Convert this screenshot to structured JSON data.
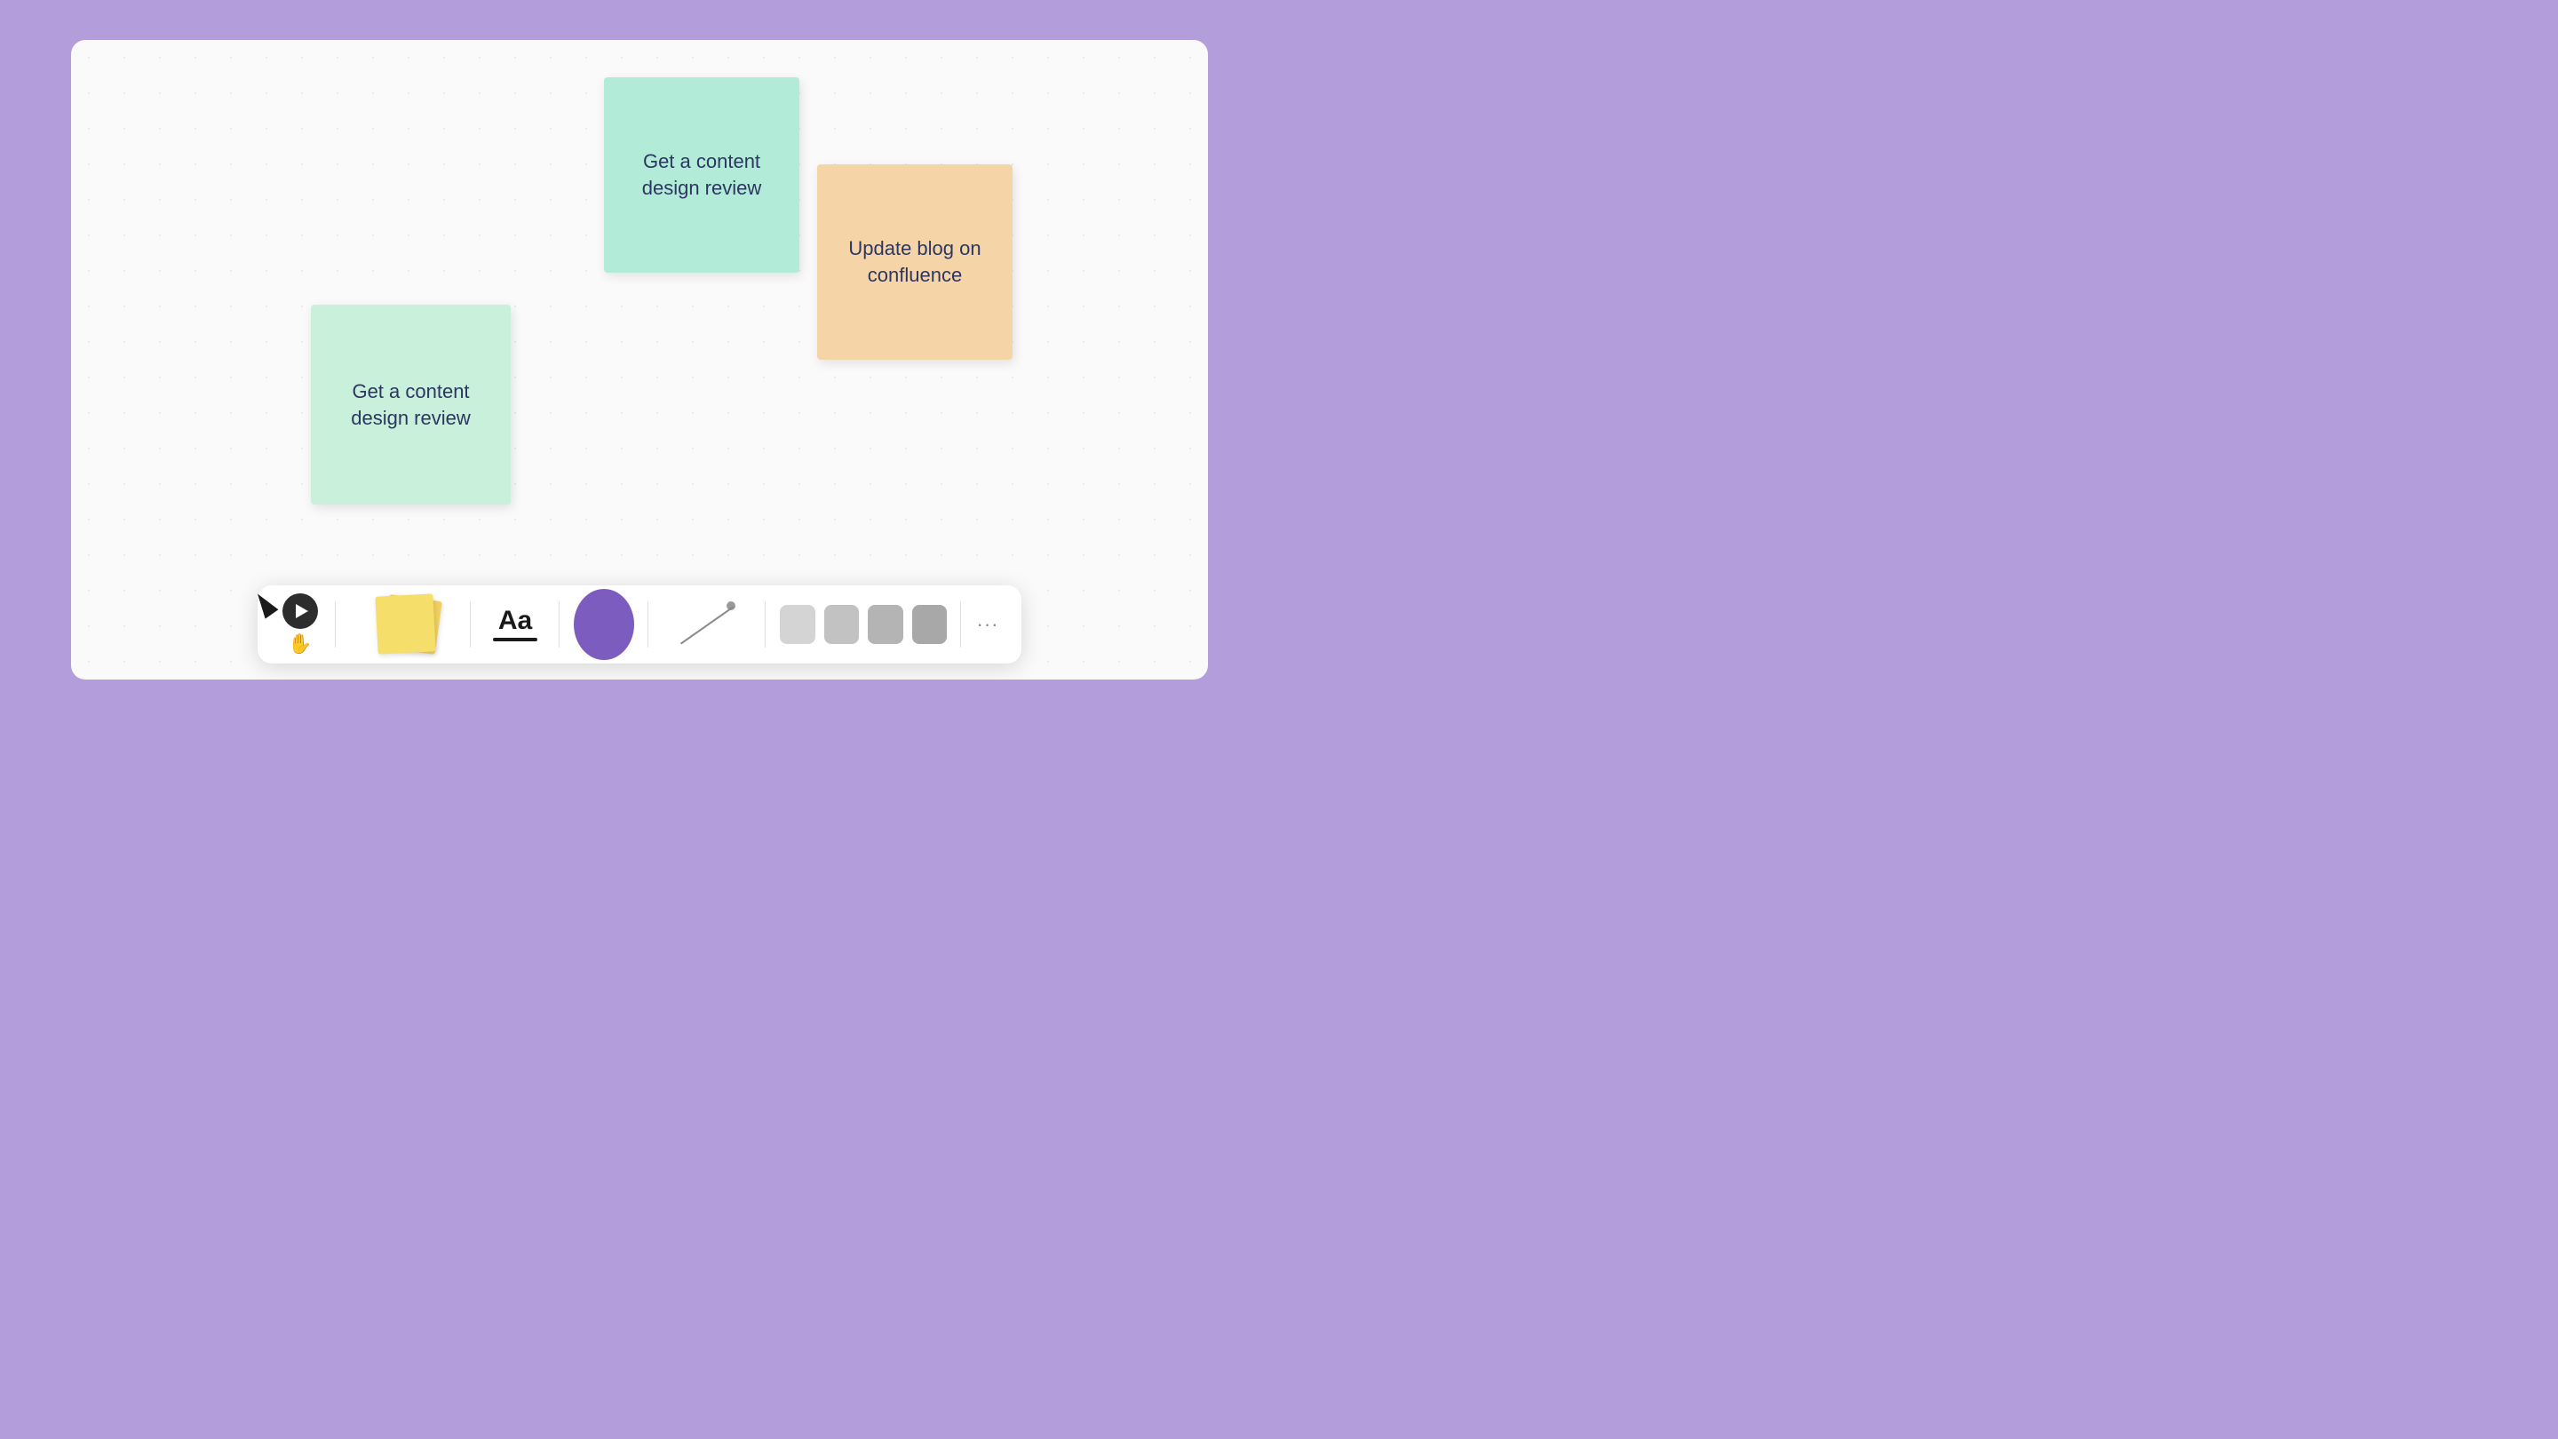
{
  "canvas": {
    "background": "#fafafa"
  },
  "notes": [
    {
      "id": "note-green-top",
      "text": "Get a content design review",
      "color": "#b2ecd8",
      "position": "top-right"
    },
    {
      "id": "note-orange",
      "text": "Update blog on confluence",
      "color": "#f5d5a8",
      "position": "right"
    },
    {
      "id": "note-green-bottom",
      "text": "Get a content design review",
      "color": "#c8f0da",
      "position": "bottom-left"
    }
  ],
  "toolbar": {
    "text_tool_label": "Aa",
    "more_label": "···",
    "swatches": [
      "#d9d9d9",
      "#c4c4c4",
      "#b0b0b0",
      "#9d9d9d"
    ]
  }
}
